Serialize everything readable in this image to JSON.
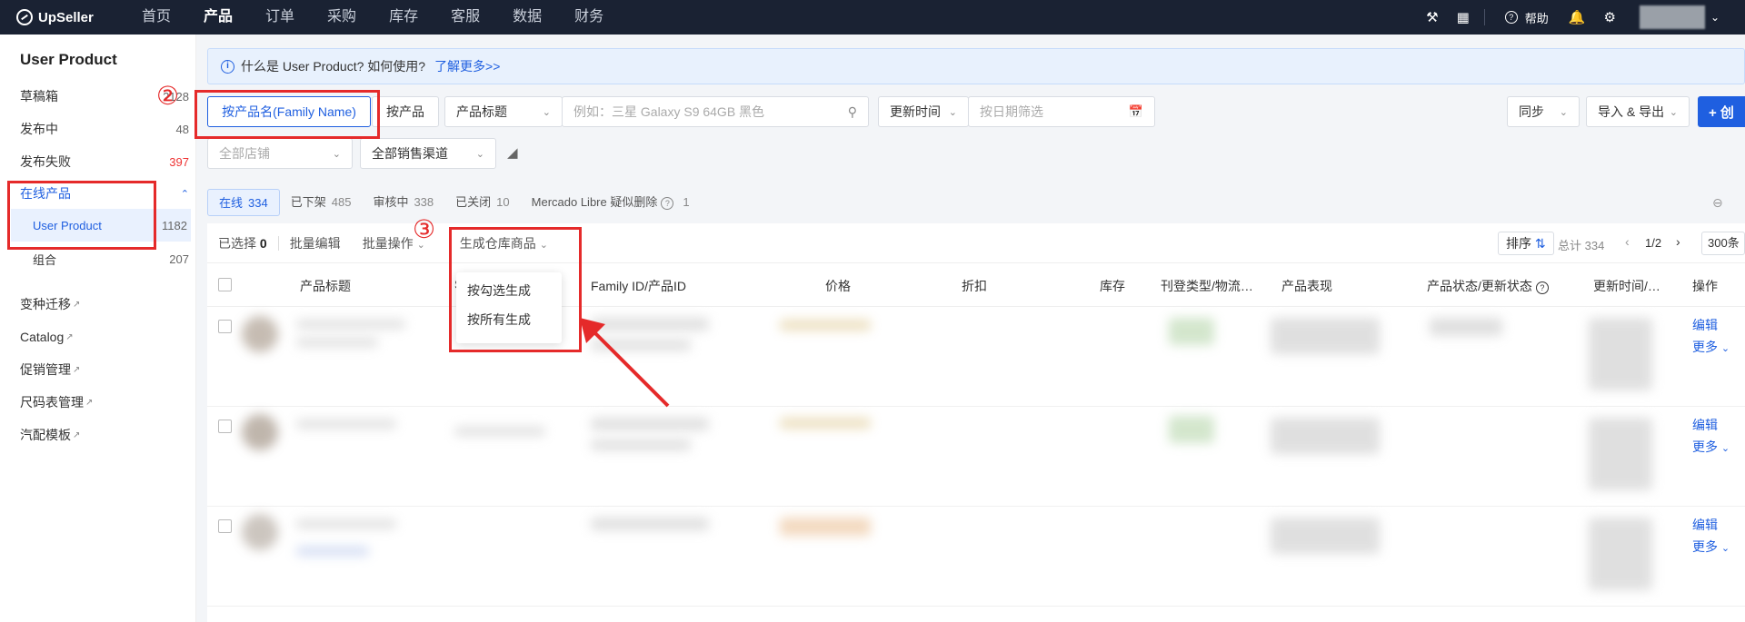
{
  "nav": {
    "logo": "UpSeller",
    "items": [
      "首页",
      "产品",
      "订单",
      "采购",
      "库存",
      "客服",
      "数据",
      "财务"
    ],
    "help": "帮助"
  },
  "sidebar": {
    "title": "User Product",
    "drafts": {
      "label": "草稿箱",
      "count": "2128"
    },
    "publishing": {
      "label": "发布中",
      "count": "48"
    },
    "failed": {
      "label": "发布失败",
      "count": "397"
    },
    "online": {
      "label": "在线产品"
    },
    "user_product": {
      "label": "User Product",
      "count": "1182"
    },
    "combo": {
      "label": "组合",
      "count": "207"
    },
    "links": [
      "变种迁移",
      "Catalog",
      "促销管理",
      "尺码表管理",
      "汽配模板"
    ]
  },
  "notice": {
    "text": "什么是 User Product? 如何使用?",
    "link": "了解更多>>"
  },
  "filters": {
    "by_family": "按产品名(Family Name)",
    "by_product": "按产品",
    "title_select": "产品标题",
    "search_placeholder": "例如：三星 Galaxy S9 64GB 黑色",
    "update_time": "更新时间",
    "date_placeholder": "按日期筛选",
    "sync": "同步",
    "import_export": "导入 & 导出",
    "create": "+ 创",
    "all_shops": "全部店铺",
    "all_channels": "全部销售渠道"
  },
  "tabs": [
    {
      "label": "在线",
      "count": "334"
    },
    {
      "label": "已下架",
      "count": "485"
    },
    {
      "label": "审核中",
      "count": "338"
    },
    {
      "label": "已关闭",
      "count": "10"
    },
    {
      "label": "Mercado Libre 疑似删除",
      "count": "1"
    }
  ],
  "toolbar": {
    "selected_label": "已选择",
    "selected_count": "0",
    "batch_edit": "批量编辑",
    "batch_ops": "批量操作",
    "generate": "生成仓库商品",
    "sort": "排序",
    "total": "总计 334",
    "page": "1/2",
    "per_page": "300条"
  },
  "dropdown": {
    "item1": "按勾选生成",
    "item2": "按所有生成"
  },
  "columns": {
    "title": "产品标题",
    "sku": "S",
    "family": "Family ID/产品ID",
    "price": "价格",
    "discount": "折扣",
    "stock": "库存",
    "listing": "刊登类型/物流…",
    "performance": "产品表现",
    "status": "产品状态/更新状态",
    "updated": "更新时间/…",
    "action": "操作"
  },
  "row_actions": {
    "edit": "编辑",
    "more": "更多"
  },
  "annotations": {
    "two": "②",
    "three": "③"
  }
}
